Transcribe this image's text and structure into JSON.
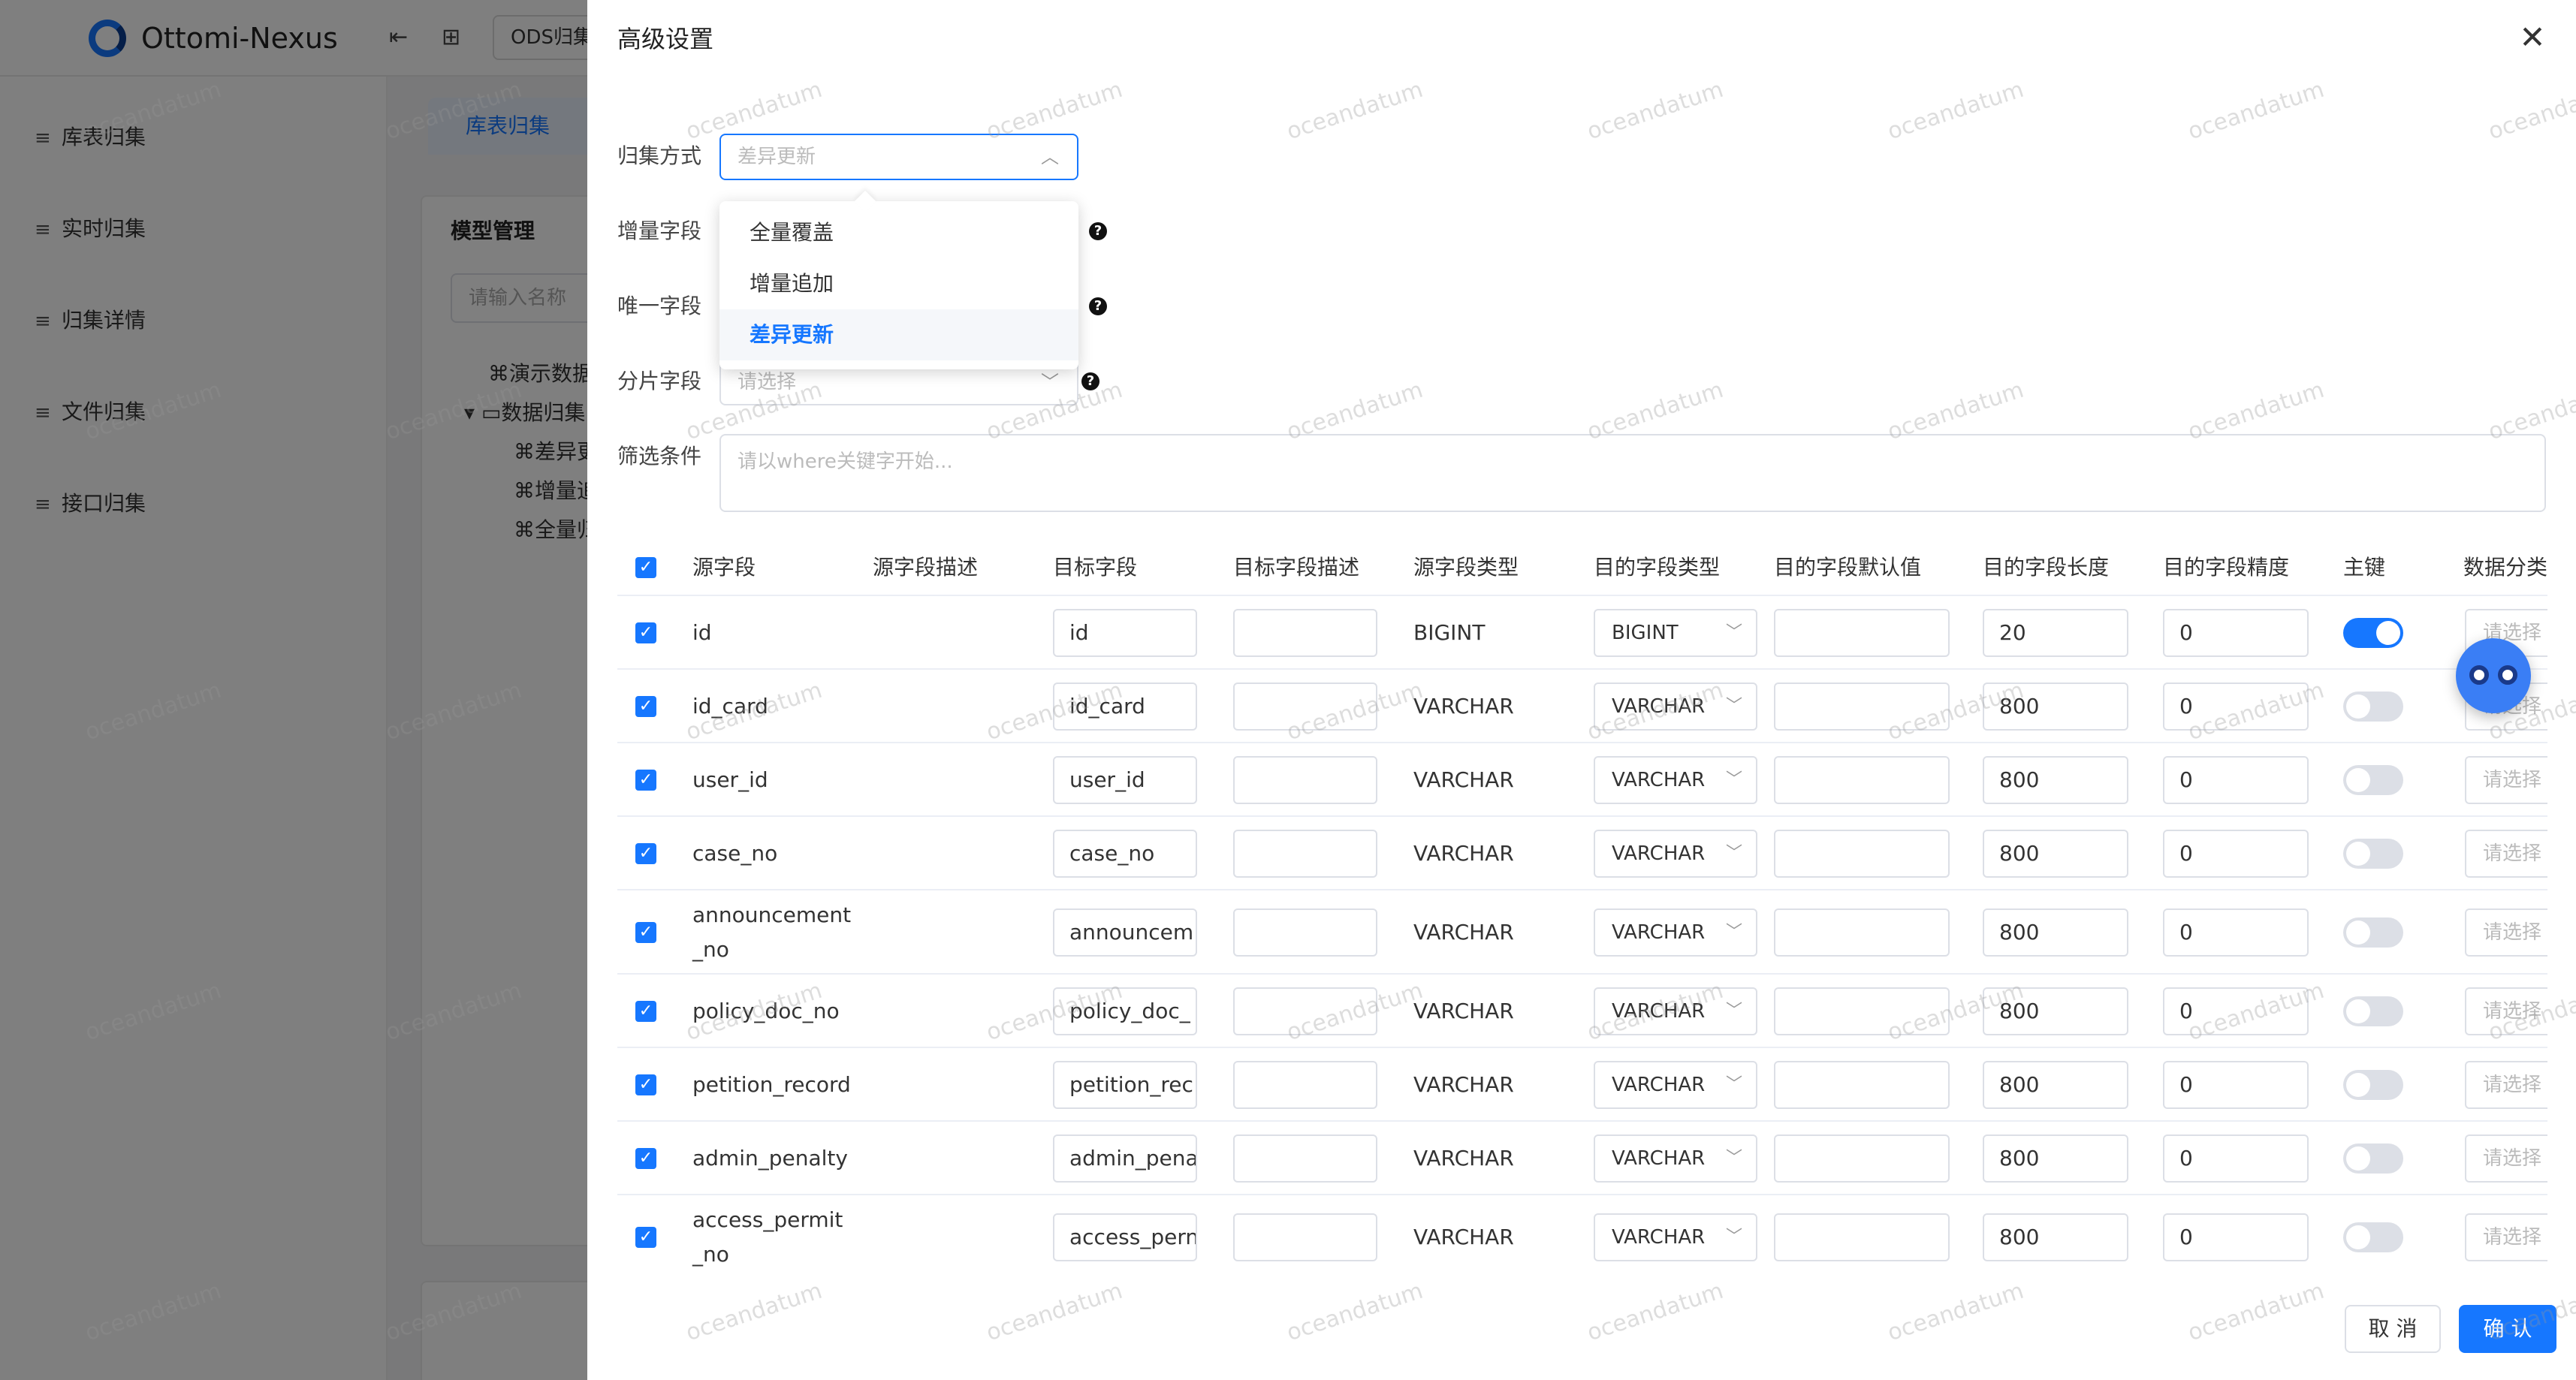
{
  "app": {
    "title": "Ottomi-Nexus",
    "top_input": "ODS归集",
    "sidebar": [
      "库表归集",
      "实时归集",
      "归集详情",
      "文件归集",
      "接口归集"
    ],
    "tab": "库表归集",
    "model_panel_title": "模型管理",
    "name_search_placeholder": "请输入名称",
    "tree": [
      "演示数据",
      "数据归集",
      "差异更",
      "增量追",
      "全量归"
    ]
  },
  "drawer": {
    "title": "高级设置",
    "form": {
      "collect_mode_label": "归集方式",
      "collect_mode_value": "差异更新",
      "increment_field_label": "增量字段",
      "unique_field_label": "唯一字段",
      "shard_field_label": "分片字段",
      "shard_field_placeholder": "请选择",
      "filter_label": "筛选条件",
      "filter_placeholder": "请以where关键字开始..."
    },
    "dropdown": {
      "options": [
        "全量覆盖",
        "增量追加",
        "差异更新"
      ],
      "selected": "差异更新"
    },
    "table": {
      "headers": [
        "源字段",
        "源字段描述",
        "目标字段",
        "目标字段描述",
        "源字段类型",
        "目的字段类型",
        "目的字段默认值",
        "目的字段长度",
        "目的字段精度",
        "主键",
        "数据分类"
      ],
      "class_placeholder": "请选择",
      "rows": [
        {
          "source": "id",
          "target": "id",
          "src_type": "BIGINT",
          "dst_type": "BIGINT",
          "length": "20",
          "precision": "0",
          "pk": true
        },
        {
          "source": "id_card",
          "target": "id_card",
          "src_type": "VARCHAR",
          "dst_type": "VARCHAR",
          "length": "800",
          "precision": "0",
          "pk": false
        },
        {
          "source": "user_id",
          "target": "user_id",
          "src_type": "VARCHAR",
          "dst_type": "VARCHAR",
          "length": "800",
          "precision": "0",
          "pk": false
        },
        {
          "source": "case_no",
          "target": "case_no",
          "src_type": "VARCHAR",
          "dst_type": "VARCHAR",
          "length": "800",
          "precision": "0",
          "pk": false
        },
        {
          "source": "announcement_no",
          "source_line1": "announcement",
          "source_line2": "_no",
          "target": "announcem",
          "src_type": "VARCHAR",
          "dst_type": "VARCHAR",
          "length": "800",
          "precision": "0",
          "pk": false
        },
        {
          "source": "policy_doc_no",
          "target": "policy_doc_",
          "src_type": "VARCHAR",
          "dst_type": "VARCHAR",
          "length": "800",
          "precision": "0",
          "pk": false
        },
        {
          "source": "petition_record",
          "target": "petition_rec",
          "src_type": "VARCHAR",
          "dst_type": "VARCHAR",
          "length": "800",
          "precision": "0",
          "pk": false
        },
        {
          "source": "admin_penalty",
          "target": "admin_pena",
          "src_type": "VARCHAR",
          "dst_type": "VARCHAR",
          "length": "800",
          "precision": "0",
          "pk": false
        },
        {
          "source": "access_permit_no",
          "source_line1": "access_permit",
          "source_line2": "_no",
          "target": "access_pern",
          "src_type": "VARCHAR",
          "dst_type": "VARCHAR",
          "length": "800",
          "precision": "0",
          "pk": false
        }
      ]
    },
    "buttons": {
      "cancel": "取 消",
      "confirm": "确 认"
    }
  },
  "watermark": "oceandatum",
  "colors": {
    "accent": "#1677ff",
    "mask": "rgba(0,0,0,0.5)"
  }
}
